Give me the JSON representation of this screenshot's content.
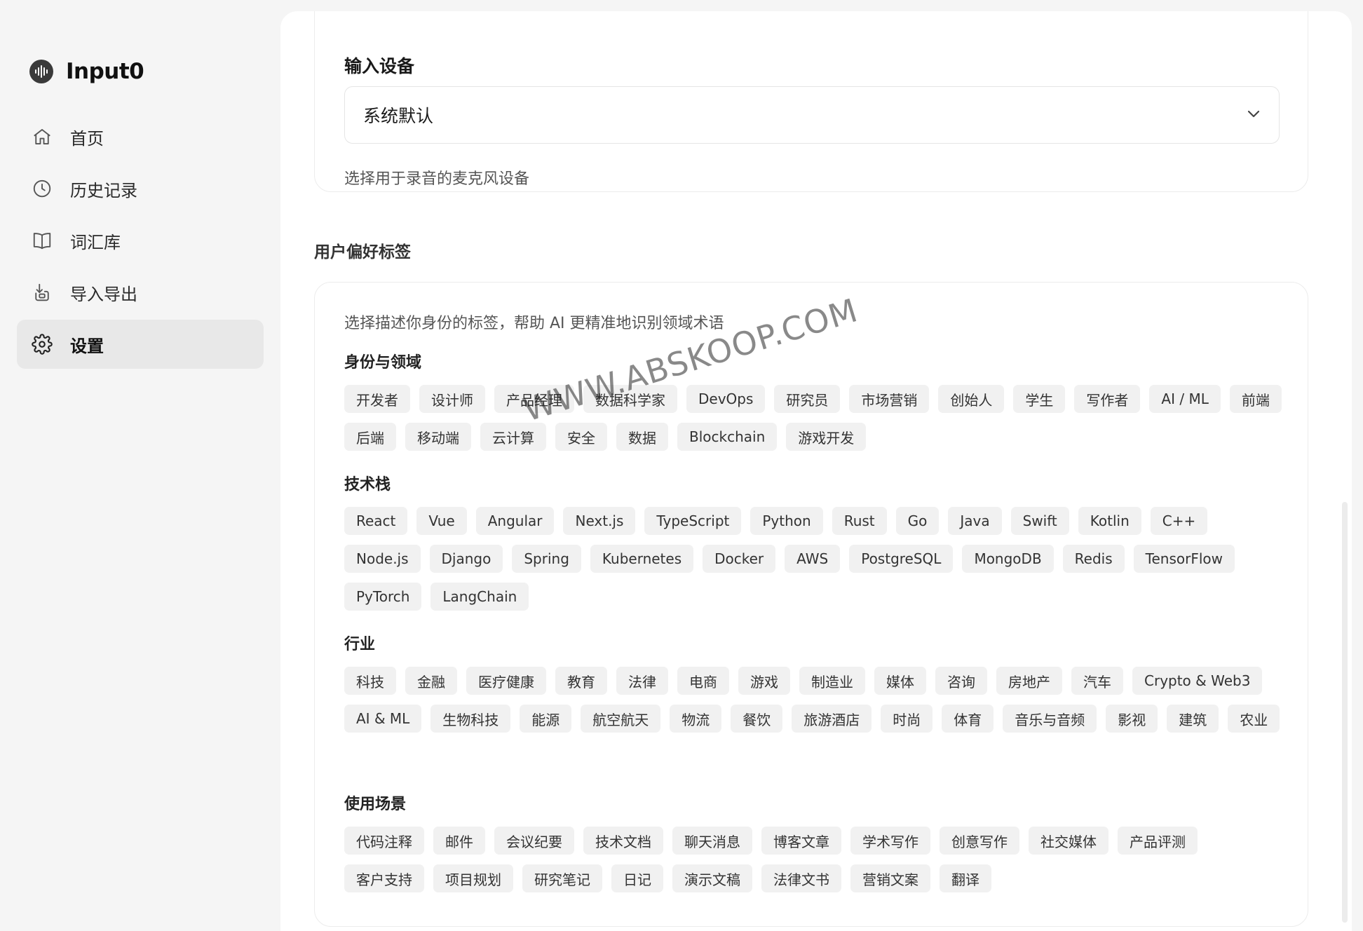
{
  "app": {
    "name": "Input0"
  },
  "sidebar": {
    "items": [
      {
        "label": "首页",
        "icon": "home-icon",
        "active": false
      },
      {
        "label": "历史记录",
        "icon": "clock-icon",
        "active": false
      },
      {
        "label": "词汇库",
        "icon": "book-icon",
        "active": false
      },
      {
        "label": "导入导出",
        "icon": "import-export-icon",
        "active": false
      },
      {
        "label": "设置",
        "icon": "gear-icon",
        "active": true
      }
    ]
  },
  "device": {
    "title": "输入设备",
    "selected": "系统默认",
    "help": "选择用于录音的麦克风设备"
  },
  "preferences": {
    "section_title": "用户偏好标签",
    "intro": "选择描述你身份的标签，帮助 AI 更精准地识别领域术语",
    "groups": [
      {
        "title": "身份与领域",
        "tags": [
          "开发者",
          "设计师",
          "产品经理",
          "数据科学家",
          "DevOps",
          "研究员",
          "市场营销",
          "创始人",
          "学生",
          "写作者",
          "AI / ML",
          "前端",
          "后端",
          "移动端",
          "云计算",
          "安全",
          "数据",
          "Blockchain",
          "游戏开发"
        ]
      },
      {
        "title": "技术栈",
        "tags": [
          "React",
          "Vue",
          "Angular",
          "Next.js",
          "TypeScript",
          "Python",
          "Rust",
          "Go",
          "Java",
          "Swift",
          "Kotlin",
          "C++",
          "Node.js",
          "Django",
          "Spring",
          "Kubernetes",
          "Docker",
          "AWS",
          "PostgreSQL",
          "MongoDB",
          "Redis",
          "TensorFlow",
          "PyTorch",
          "LangChain"
        ]
      },
      {
        "title": "行业",
        "tags": [
          "科技",
          "金融",
          "医疗健康",
          "教育",
          "法律",
          "电商",
          "游戏",
          "制造业",
          "媒体",
          "咨询",
          "房地产",
          "汽车",
          "Crypto & Web3",
          "AI & ML",
          "生物科技",
          "能源",
          "航空航天",
          "物流",
          "餐饮",
          "旅游酒店",
          "时尚",
          "体育",
          "音乐与音频",
          "影视",
          "建筑",
          "农业"
        ]
      },
      {
        "title": "使用场景",
        "tags": [
          "代码注释",
          "邮件",
          "会议纪要",
          "技术文档",
          "聊天消息",
          "博客文章",
          "学术写作",
          "创意写作",
          "社交媒体",
          "产品评测",
          "客户支持",
          "项目规划",
          "研究笔记",
          "日记",
          "演示文稿",
          "法律文书",
          "营销文案",
          "翻译"
        ]
      }
    ]
  },
  "watermark": "WWW.ABSKOOP.COM",
  "colors": {
    "background": "#f5f5f5",
    "panel": "#ffffff",
    "chip": "#f1f1f1",
    "active_nav": "#e8e8e8"
  }
}
